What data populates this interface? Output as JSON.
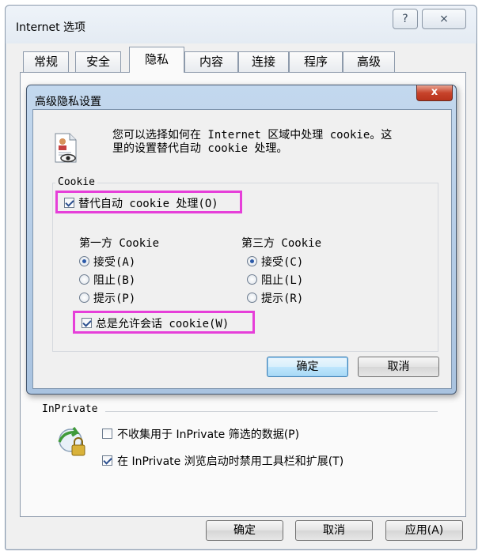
{
  "outer_window": {
    "title": "Internet 选项",
    "help_glyph": "?",
    "close_glyph": "⨯",
    "tabs": [
      {
        "label": "常规",
        "active": false
      },
      {
        "label": "安全",
        "active": false
      },
      {
        "label": "隐私",
        "active": true
      },
      {
        "label": "内容",
        "active": false
      },
      {
        "label": "连接",
        "active": false
      },
      {
        "label": "程序",
        "active": false
      },
      {
        "label": "高级",
        "active": false
      }
    ],
    "inprivate": {
      "group_label": "InPrivate",
      "icon": "inprivate-lock-icon",
      "option1": {
        "label": "不收集用于 InPrivate 筛选的数据(P)",
        "checked": false
      },
      "option2": {
        "label": "在 InPrivate 浏览启动时禁用工具栏和扩展(T)",
        "checked": true
      }
    },
    "buttons": {
      "ok": "确定",
      "cancel": "取消",
      "apply": "应用(A)"
    }
  },
  "inner_dialog": {
    "title": "高级隐私设置",
    "close_glyph": "x",
    "description_line1": "您可以选择如何在 Internet 区域中处理 cookie。这",
    "description_line2": "里的设置替代自动 cookie 处理。",
    "icon": "privacy-document-eye-icon",
    "cookie_group_label": "Cookie",
    "override_auto": {
      "label": "替代自动 cookie 处理(O)",
      "checked": true
    },
    "first_party": {
      "heading": "第一方 Cookie",
      "options": [
        {
          "label": "接受(A)",
          "selected": true
        },
        {
          "label": "阻止(B)",
          "selected": false
        },
        {
          "label": "提示(P)",
          "selected": false
        }
      ]
    },
    "third_party": {
      "heading": "第三方 Cookie",
      "options": [
        {
          "label": "接受(C)",
          "selected": true
        },
        {
          "label": "阻止(L)",
          "selected": false
        },
        {
          "label": "提示(R)",
          "selected": false
        }
      ]
    },
    "always_session": {
      "label": "总是允许会话 cookie(W)",
      "checked": true
    },
    "buttons": {
      "ok": "确定",
      "cancel": "取消"
    },
    "highlight_color": "#e63fd9"
  }
}
